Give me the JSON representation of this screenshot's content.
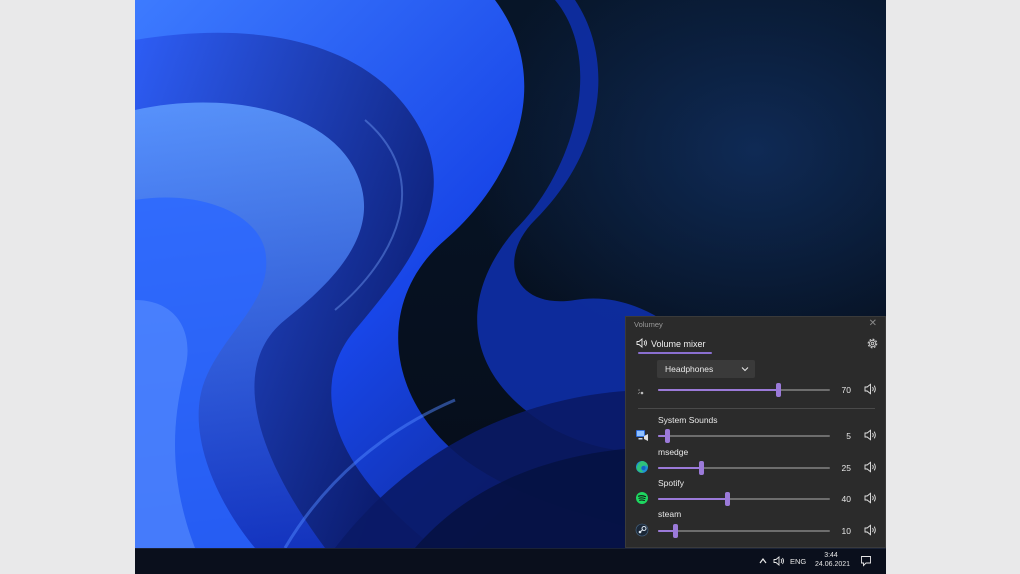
{
  "mixer": {
    "window_title": "Volumey",
    "tab_label": "Volume mixer",
    "device": {
      "selected": "Headphones",
      "volume": 70
    },
    "sessions": [
      {
        "name": "System Sounds",
        "volume": 5,
        "icon": "system-sounds-icon"
      },
      {
        "name": "msedge",
        "volume": 25,
        "icon": "edge-icon"
      },
      {
        "name": "Spotify",
        "volume": 40,
        "icon": "spotify-icon"
      },
      {
        "name": "steam",
        "volume": 10,
        "icon": "steam-icon"
      }
    ],
    "accent_color": "#9b7ad9"
  },
  "taskbar": {
    "language": "ENG",
    "time": "3:44",
    "date": "24.06.2021"
  }
}
